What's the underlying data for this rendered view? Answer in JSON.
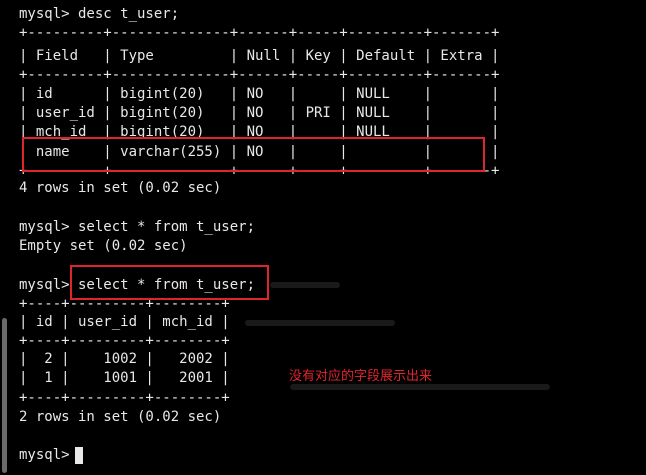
{
  "terminal": {
    "lines": [
      "mysql> desc t_user;",
      "+---------+--------------+------+-----+---------+-------+",
      "| Field   | Type         | Null | Key | Default | Extra |",
      "+---------+--------------+------+-----+---------+-------+",
      "| id      | bigint(20)   | NO   |     | NULL    |       |",
      "| user_id | bigint(20)   | NO   | PRI | NULL    |       |",
      "| mch_id  | bigint(20)   | NO   |     | NULL    |       |",
      "| name    | varchar(255) | NO   |     |         |       |",
      "+---------+--------------+------+-----+---------+-------+",
      "4 rows in set (0.02 sec)",
      "",
      "mysql> select * from t_user;",
      "Empty set (0.02 sec)",
      "",
      "mysql> select * from t_user;",
      "+----+---------+--------+",
      "| id | user_id | mch_id |",
      "+----+---------+--------+",
      "|  2 |    1002 |   2002 |",
      "|  1 |    1001 |   2001 |",
      "+----+---------+--------+",
      "2 rows in set (0.02 sec)",
      "",
      "mysql> "
    ]
  },
  "annotation": {
    "text": "没有对应的字段展示出来",
    "color": "#e0242d"
  },
  "colors": {
    "background": "#000000",
    "text": "#e8e8e8",
    "highlight": "#e0242d"
  }
}
